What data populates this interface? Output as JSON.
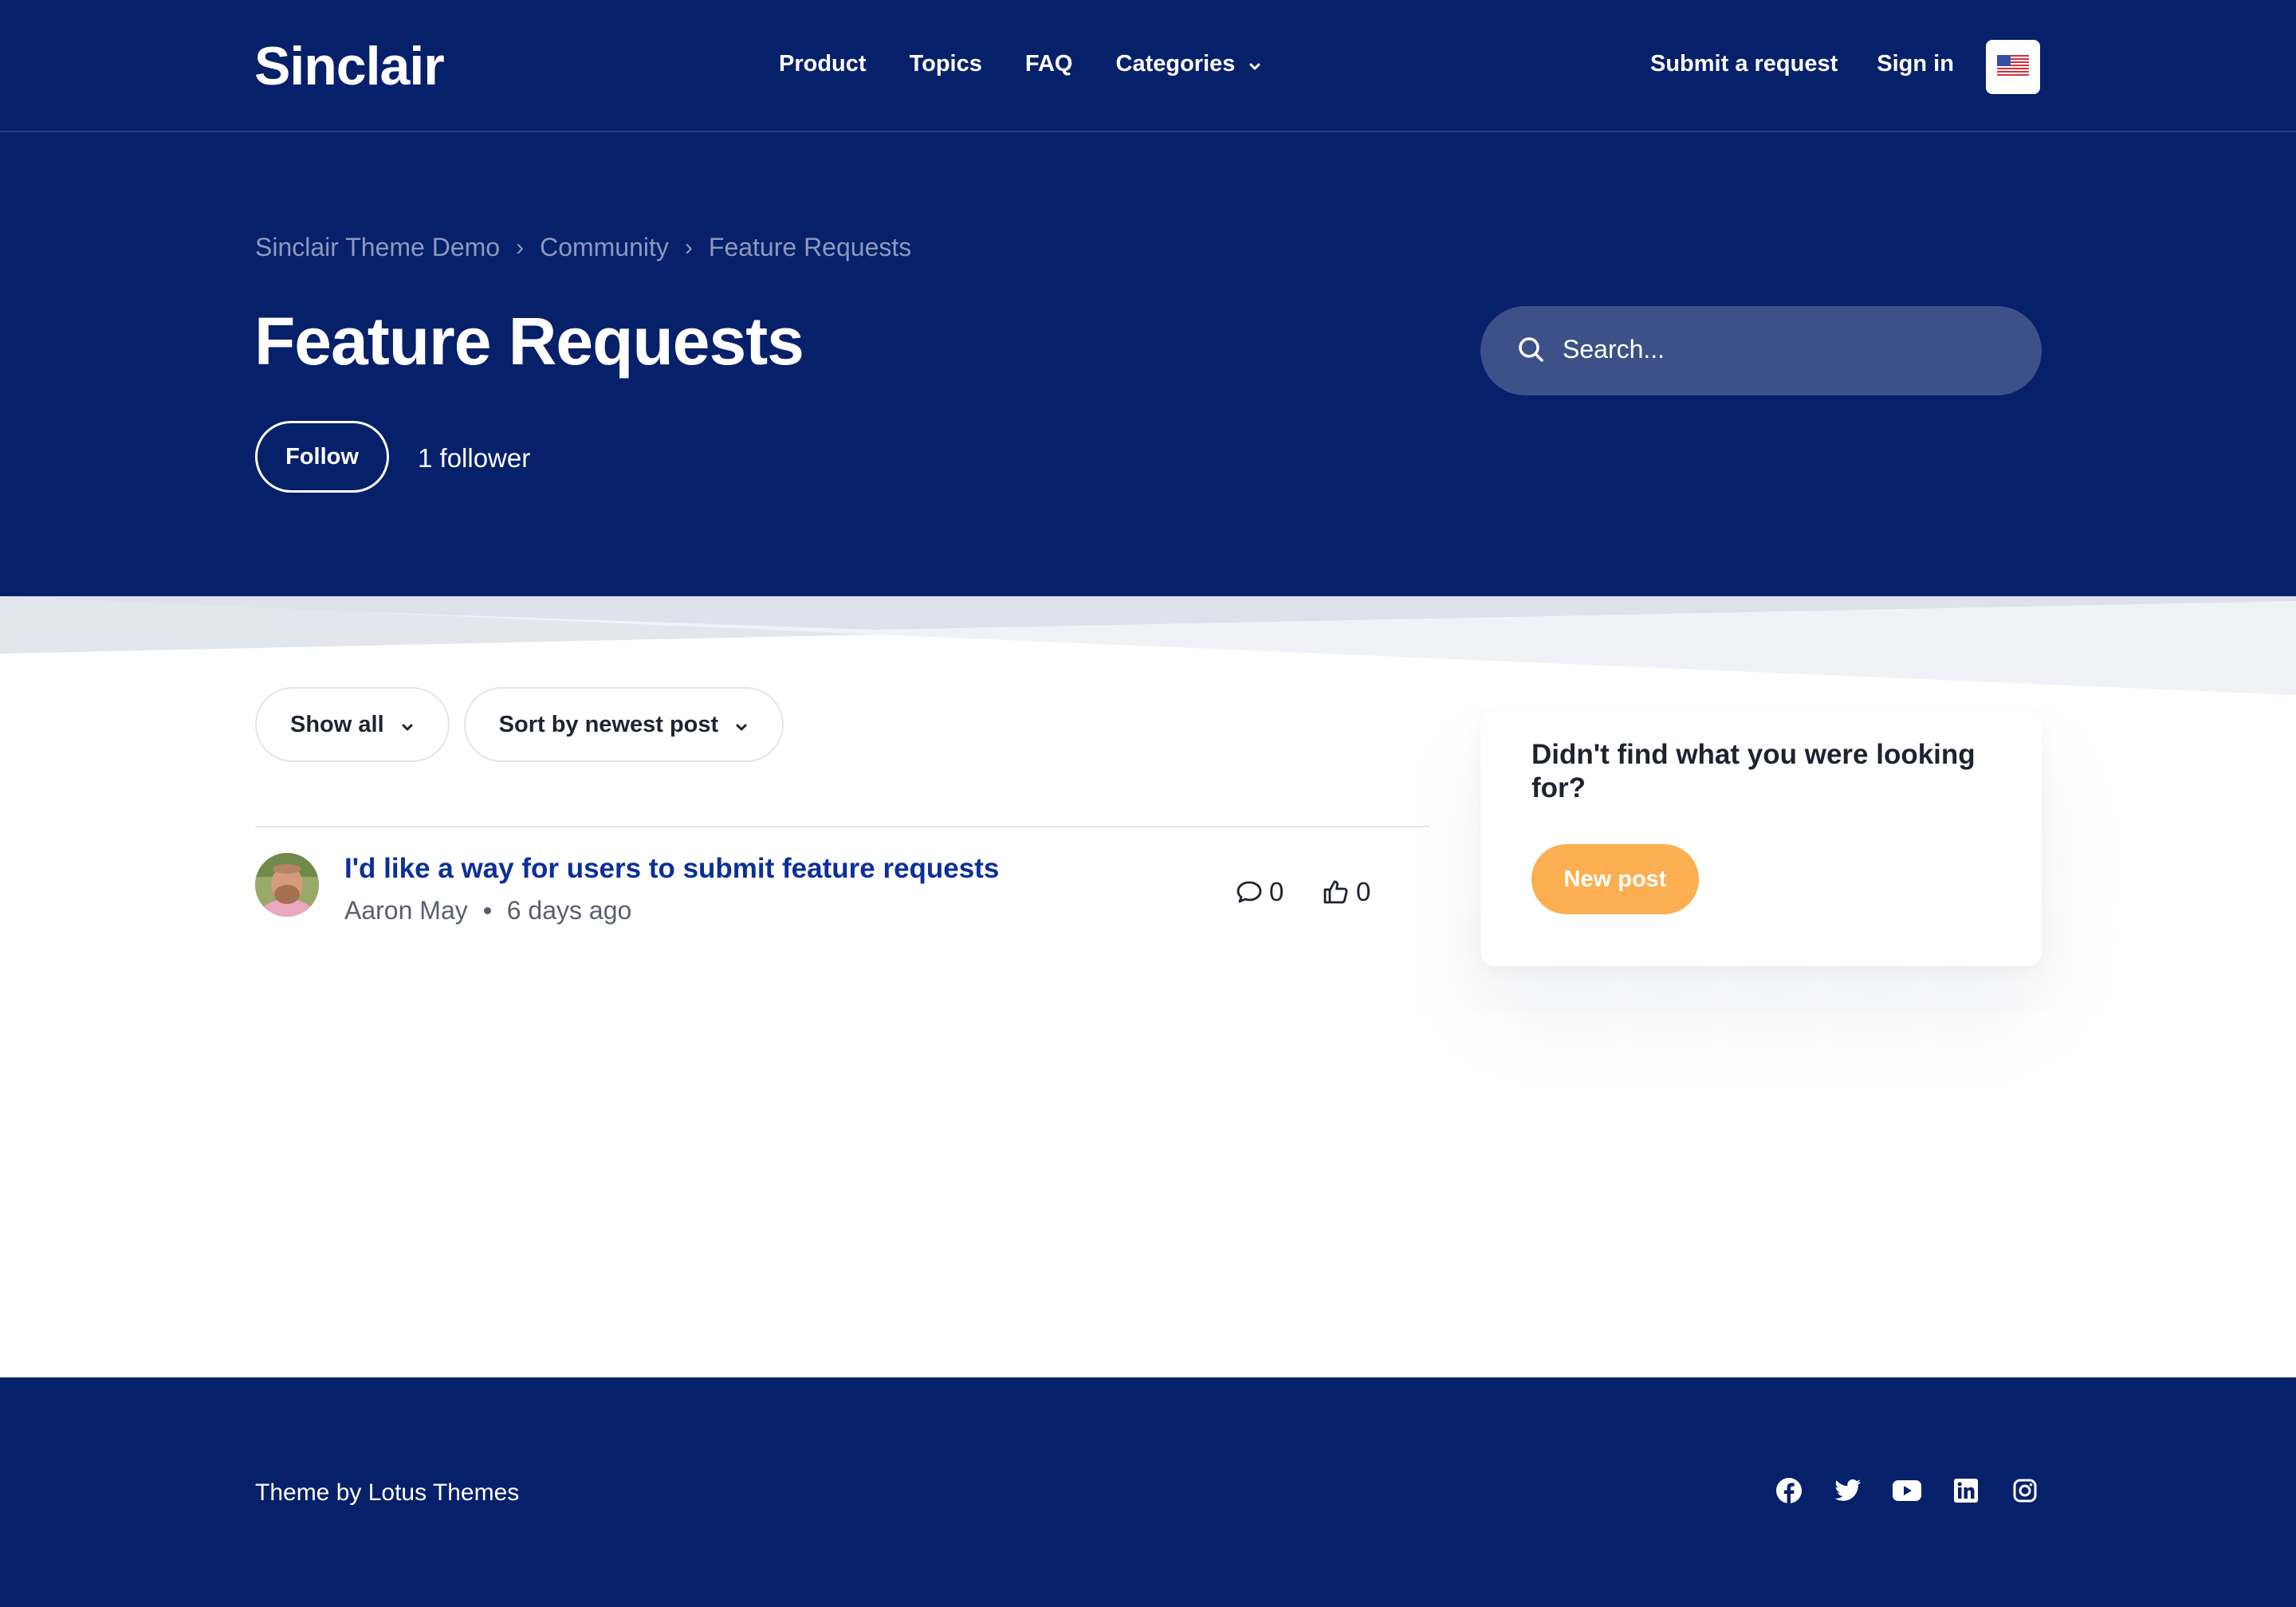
{
  "brand": {
    "logo_text": "Sinclair"
  },
  "nav": {
    "links": [
      "Product",
      "Topics",
      "FAQ",
      "Categories"
    ],
    "submit_request": "Submit a request",
    "sign_in": "Sign in",
    "language_flag": "us-flag-icon"
  },
  "breadcrumb": [
    "Sinclair Theme Demo",
    "Community",
    "Feature Requests"
  ],
  "page": {
    "title": "Feature Requests",
    "follow_label": "Follow",
    "followers_text": "1 follower"
  },
  "search": {
    "placeholder": "Search..."
  },
  "filters": {
    "show": "Show all",
    "sort": "Sort by newest post"
  },
  "posts": [
    {
      "title": "I'd like a way for users to submit feature requests",
      "author": "Aaron May",
      "time": "6 days ago",
      "comments": "0",
      "votes": "0"
    }
  ],
  "sidebar": {
    "prompt": "Didn't find what you were looking for?",
    "new_post": "New post"
  },
  "footer": {
    "credit": "Theme by Lotus Themes",
    "social_icons": [
      "facebook-icon",
      "twitter-icon",
      "youtube-icon",
      "linkedin-icon",
      "instagram-icon"
    ]
  },
  "colors": {
    "header_bg": "#07206a",
    "link_blue": "#0c2f99",
    "accent_orange": "#fbaf50",
    "search_bg": "#3d5188"
  }
}
